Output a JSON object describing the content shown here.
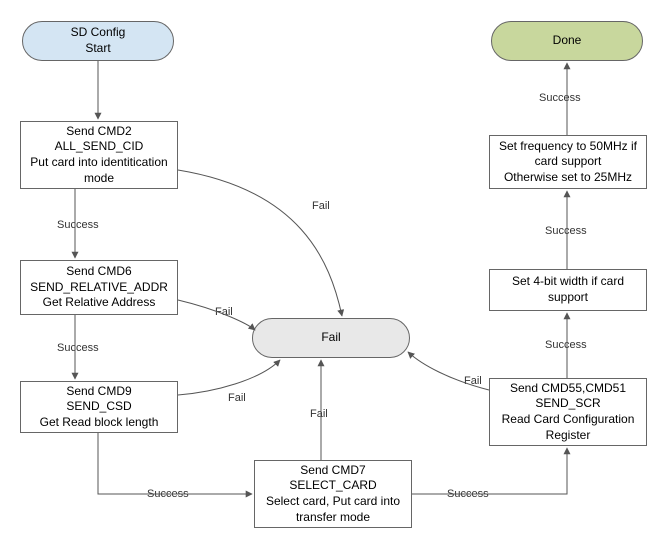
{
  "start": {
    "label": "SD Config\nStart"
  },
  "done": {
    "label": "Done"
  },
  "fail": {
    "label": "Fail"
  },
  "cmd2": {
    "label": "Send CMD2\nALL_SEND_CID\nPut card into identitication\nmode"
  },
  "cmd6": {
    "label": "Send CMD6\nSEND_RELATIVE_ADDR\nGet Relative Address"
  },
  "cmd9": {
    "label": "Send CMD9\nSEND_CSD\nGet Read block length"
  },
  "cmd7": {
    "label": "Send CMD7\nSELECT_CARD\nSelect card, Put card into\ntransfer mode"
  },
  "cmd55": {
    "label": "Send CMD55,CMD51\nSEND_SCR\nRead Card Configuration\nRegister"
  },
  "set4bit": {
    "label": "Set 4-bit width if card\nsupport"
  },
  "setfreq": {
    "label": "Set frequency to 50MHz if\ncard support\nOtherwise set to 25MHz"
  },
  "edge_labels": {
    "success": "Success",
    "fail": "Fail"
  }
}
